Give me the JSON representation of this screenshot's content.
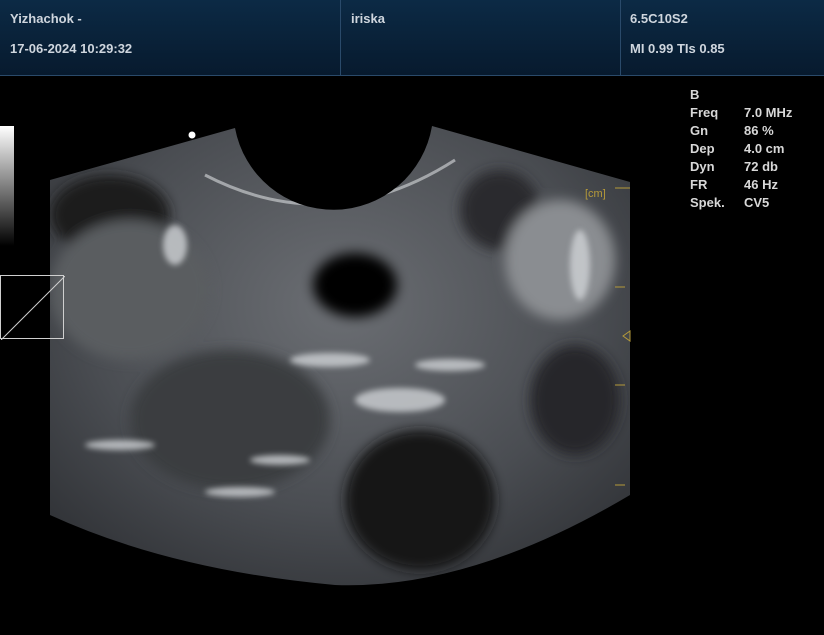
{
  "header": {
    "patient": "Yizhachok -",
    "datetime": "17-06-2024 10:29:32",
    "operator": "iriska",
    "probe": "6.5C10S2",
    "indices": "MI 0.99 TIs 0.85"
  },
  "params": {
    "mode": "B",
    "rows": [
      {
        "key": "Freq",
        "value": "7.0 MHz"
      },
      {
        "key": "Gn",
        "value": "86 %"
      },
      {
        "key": "Dep",
        "value": "4.0 cm"
      },
      {
        "key": "Dyn",
        "value": "72 db"
      },
      {
        "key": "FR",
        "value": "46 Hz"
      },
      {
        "key": "Spek.",
        "value": "CV5"
      }
    ]
  },
  "scale_unit": "[cm]"
}
